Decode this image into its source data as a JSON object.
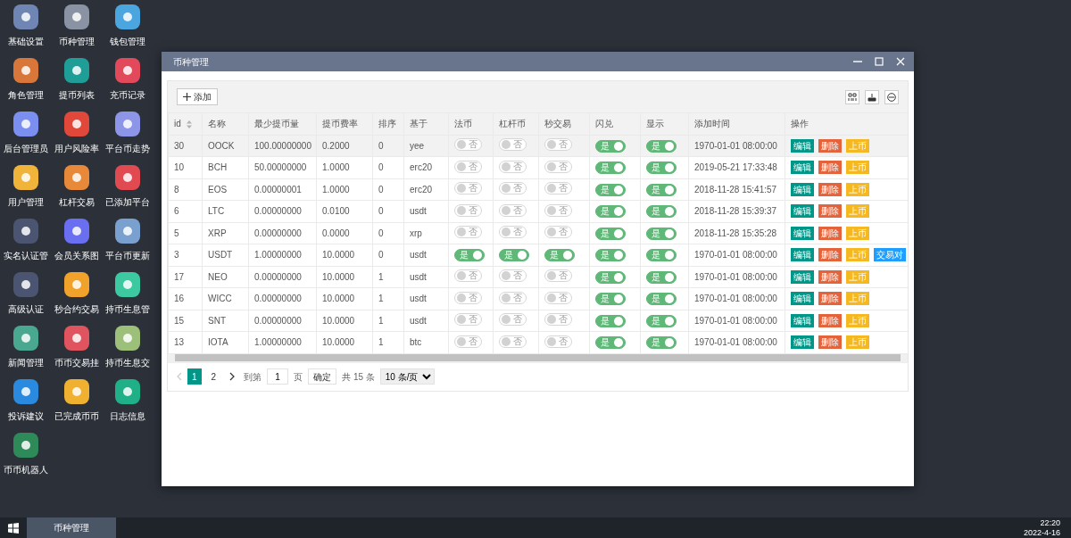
{
  "desktop_icons": [
    {
      "label": "基础设置",
      "color": "#6f86b5"
    },
    {
      "label": "币种管理",
      "color": "#8a93a3"
    },
    {
      "label": "钱包管理",
      "color": "#4ba6e0"
    },
    {
      "label": "角色管理",
      "color": "#d9773a"
    },
    {
      "label": "提币列表",
      "color": "#1f9e98"
    },
    {
      "label": "充币记录",
      "color": "#e24a5c"
    },
    {
      "label": "后台管理员",
      "color": "#7b8ff0"
    },
    {
      "label": "用户风险率",
      "color": "#e2483a"
    },
    {
      "label": "平台币走势",
      "color": "#8c95e8"
    },
    {
      "label": "用户管理",
      "color": "#f0b43a"
    },
    {
      "label": "杠杆交易",
      "color": "#e8893a"
    },
    {
      "label": "已添加平台",
      "color": "#e24a52"
    },
    {
      "label": "实名认证管",
      "color": "#4b5470"
    },
    {
      "label": "会员关系图",
      "color": "#6a6ef0"
    },
    {
      "label": "平台币更新",
      "color": "#7aa0d0"
    },
    {
      "label": "高级认证",
      "color": "#4b5470"
    },
    {
      "label": "秒合约交易",
      "color": "#f0a22a"
    },
    {
      "label": "持币生息管",
      "color": "#3cc8a0"
    },
    {
      "label": "新闻管理",
      "color": "#4aa890"
    },
    {
      "label": "币币交易挂",
      "color": "#e05460"
    },
    {
      "label": "持币生息交",
      "color": "#9cc07a"
    },
    {
      "label": "投诉建议",
      "color": "#2a8ae0"
    },
    {
      "label": "已完成币币",
      "color": "#f0b030"
    },
    {
      "label": "日志信息",
      "color": "#20b088"
    },
    {
      "label": "币币机器人",
      "color": "#2f8a5a"
    }
  ],
  "window": {
    "title": "币种管理"
  },
  "toolbar": {
    "add_button": "添加"
  },
  "table": {
    "columns": [
      {
        "label": "id",
        "sortable": true
      },
      {
        "label": "名称",
        "sortable": false
      },
      {
        "label": "最少提币量",
        "sortable": false
      },
      {
        "label": "提币费率",
        "sortable": false
      },
      {
        "label": "排序",
        "sortable": false
      },
      {
        "label": "基于",
        "sortable": false
      },
      {
        "label": "法币",
        "sortable": false
      },
      {
        "label": "杠杆币",
        "sortable": false
      },
      {
        "label": "秒交易",
        "sortable": false
      },
      {
        "label": "闪兑",
        "sortable": false
      },
      {
        "label": "显示",
        "sortable": false
      },
      {
        "label": "添加时间",
        "sortable": false
      },
      {
        "label": "操作",
        "sortable": false
      }
    ],
    "rows": [
      {
        "selected": true,
        "cells": [
          "30",
          "OOCK",
          "100.00000000",
          "0.2000",
          "0",
          "yee"
        ],
        "switches": [
          {
            "on": false,
            "text": "否"
          },
          {
            "on": false,
            "text": "否"
          },
          {
            "on": false,
            "text": "否"
          },
          {
            "on": true,
            "text": "是"
          },
          {
            "on": true,
            "text": "是"
          }
        ],
        "time": "1970-01-01 08:00:00",
        "actions": [
          {
            "kind": "edit",
            "label": "编辑"
          },
          {
            "kind": "delete",
            "label": "删除"
          },
          {
            "kind": "list",
            "label": "上币"
          }
        ]
      },
      {
        "selected": false,
        "cells": [
          "10",
          "BCH",
          "50.00000000",
          "1.0000",
          "0",
          "erc20"
        ],
        "switches": [
          {
            "on": false,
            "text": "否"
          },
          {
            "on": false,
            "text": "否"
          },
          {
            "on": false,
            "text": "否"
          },
          {
            "on": true,
            "text": "是"
          },
          {
            "on": true,
            "text": "是"
          }
        ],
        "time": "2019-05-21 17:33:48",
        "actions": [
          {
            "kind": "edit",
            "label": "编辑"
          },
          {
            "kind": "delete",
            "label": "删除"
          },
          {
            "kind": "list",
            "label": "上币"
          }
        ]
      },
      {
        "selected": false,
        "cells": [
          "8",
          "EOS",
          "0.00000001",
          "1.0000",
          "0",
          "erc20"
        ],
        "switches": [
          {
            "on": false,
            "text": "否"
          },
          {
            "on": false,
            "text": "否"
          },
          {
            "on": false,
            "text": "否"
          },
          {
            "on": true,
            "text": "是"
          },
          {
            "on": true,
            "text": "是"
          }
        ],
        "time": "2018-11-28 15:41:57",
        "actions": [
          {
            "kind": "edit",
            "label": "编辑"
          },
          {
            "kind": "delete",
            "label": "删除"
          },
          {
            "kind": "list",
            "label": "上币"
          }
        ]
      },
      {
        "selected": false,
        "cells": [
          "6",
          "LTC",
          "0.00000000",
          "0.0100",
          "0",
          "usdt"
        ],
        "switches": [
          {
            "on": false,
            "text": "否"
          },
          {
            "on": false,
            "text": "否"
          },
          {
            "on": false,
            "text": "否"
          },
          {
            "on": true,
            "text": "是"
          },
          {
            "on": true,
            "text": "是"
          }
        ],
        "time": "2018-11-28 15:39:37",
        "actions": [
          {
            "kind": "edit",
            "label": "编辑"
          },
          {
            "kind": "delete",
            "label": "删除"
          },
          {
            "kind": "list",
            "label": "上币"
          }
        ]
      },
      {
        "selected": false,
        "cells": [
          "5",
          "XRP",
          "0.00000000",
          "0.0000",
          "0",
          "xrp"
        ],
        "switches": [
          {
            "on": false,
            "text": "否"
          },
          {
            "on": false,
            "text": "否"
          },
          {
            "on": false,
            "text": "否"
          },
          {
            "on": true,
            "text": "是"
          },
          {
            "on": true,
            "text": "是"
          }
        ],
        "time": "2018-11-28 15:35:28",
        "actions": [
          {
            "kind": "edit",
            "label": "编辑"
          },
          {
            "kind": "delete",
            "label": "删除"
          },
          {
            "kind": "list",
            "label": "上币"
          }
        ]
      },
      {
        "selected": false,
        "cells": [
          "3",
          "USDT",
          "1.00000000",
          "10.0000",
          "0",
          "usdt"
        ],
        "switches": [
          {
            "on": true,
            "text": "是"
          },
          {
            "on": true,
            "text": "是"
          },
          {
            "on": true,
            "text": "是"
          },
          {
            "on": true,
            "text": "是"
          },
          {
            "on": true,
            "text": "是"
          }
        ],
        "time": "1970-01-01 08:00:00",
        "actions": [
          {
            "kind": "edit",
            "label": "编辑"
          },
          {
            "kind": "delete",
            "label": "删除"
          },
          {
            "kind": "list",
            "label": "上币"
          },
          {
            "kind": "pair",
            "label": "交易对"
          }
        ]
      },
      {
        "selected": false,
        "cells": [
          "17",
          "NEO",
          "0.00000000",
          "10.0000",
          "1",
          "usdt"
        ],
        "switches": [
          {
            "on": false,
            "text": "否"
          },
          {
            "on": false,
            "text": "否"
          },
          {
            "on": false,
            "text": "否"
          },
          {
            "on": true,
            "text": "是"
          },
          {
            "on": true,
            "text": "是"
          }
        ],
        "time": "1970-01-01 08:00:00",
        "actions": [
          {
            "kind": "edit",
            "label": "编辑"
          },
          {
            "kind": "delete",
            "label": "删除"
          },
          {
            "kind": "list",
            "label": "上币"
          }
        ]
      },
      {
        "selected": false,
        "cells": [
          "16",
          "WICC",
          "0.00000000",
          "10.0000",
          "1",
          "usdt"
        ],
        "switches": [
          {
            "on": false,
            "text": "否"
          },
          {
            "on": false,
            "text": "否"
          },
          {
            "on": false,
            "text": "否"
          },
          {
            "on": true,
            "text": "是"
          },
          {
            "on": true,
            "text": "是"
          }
        ],
        "time": "1970-01-01 08:00:00",
        "actions": [
          {
            "kind": "edit",
            "label": "编辑"
          },
          {
            "kind": "delete",
            "label": "删除"
          },
          {
            "kind": "list",
            "label": "上币"
          }
        ]
      },
      {
        "selected": false,
        "cells": [
          "15",
          "SNT",
          "0.00000000",
          "10.0000",
          "1",
          "usdt"
        ],
        "switches": [
          {
            "on": false,
            "text": "否"
          },
          {
            "on": false,
            "text": "否"
          },
          {
            "on": false,
            "text": "否"
          },
          {
            "on": true,
            "text": "是"
          },
          {
            "on": true,
            "text": "是"
          }
        ],
        "time": "1970-01-01 08:00:00",
        "actions": [
          {
            "kind": "edit",
            "label": "编辑"
          },
          {
            "kind": "delete",
            "label": "删除"
          },
          {
            "kind": "list",
            "label": "上币"
          }
        ]
      },
      {
        "selected": false,
        "cells": [
          "13",
          "IOTA",
          "1.00000000",
          "10.0000",
          "1",
          "btc"
        ],
        "switches": [
          {
            "on": false,
            "text": "否"
          },
          {
            "on": false,
            "text": "否"
          },
          {
            "on": false,
            "text": "否"
          },
          {
            "on": true,
            "text": "是"
          },
          {
            "on": true,
            "text": "是"
          }
        ],
        "time": "1970-01-01 08:00:00",
        "actions": [
          {
            "kind": "edit",
            "label": "编辑"
          },
          {
            "kind": "delete",
            "label": "删除"
          },
          {
            "kind": "list",
            "label": "上币"
          }
        ]
      }
    ]
  },
  "pagination": {
    "pages": [
      {
        "label": "1",
        "selected": true
      },
      {
        "label": "2",
        "selected": false
      }
    ],
    "goto_label": "到第",
    "goto_value": "1",
    "page_unit": "页",
    "confirm": "确定",
    "total": "共 15 条",
    "page_size": "10 条/页"
  },
  "taskbar": {
    "task": "币种管理",
    "time": "22:20",
    "date": "2022-4-16"
  }
}
